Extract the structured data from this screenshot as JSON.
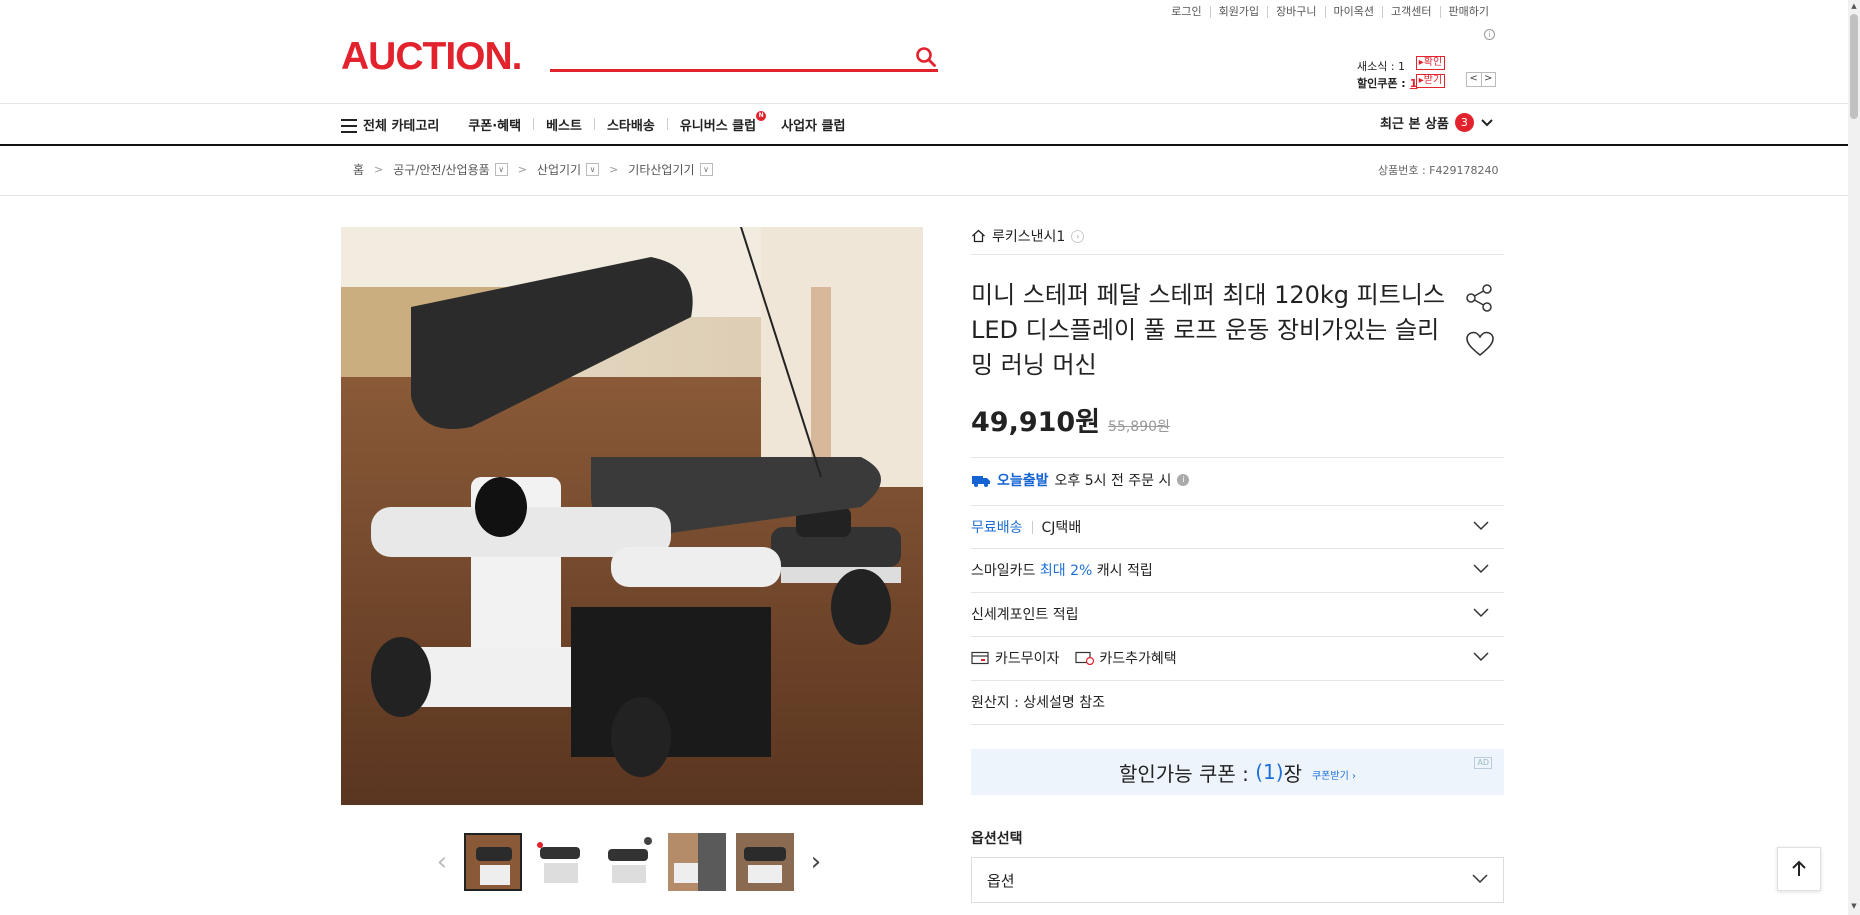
{
  "top_links": [
    "로그인",
    "회원가입",
    "장바구니",
    "마이옥션",
    "고객센터",
    "판매하기"
  ],
  "logo": "AUCTION.",
  "search": {
    "placeholder": ""
  },
  "mini": {
    "news_label": "새소식 : 1",
    "news_btn": "▸확인",
    "coupon_label": "할인쿠폰 :",
    "coupon_count": "1",
    "coupon_btn": "▸받기",
    "prev": "<",
    "next": ">"
  },
  "nav": {
    "all_category": "전체 카테고리",
    "items": [
      "쿠폰·혜택",
      "베스트",
      "스타배송",
      "유니버스 클럽",
      "사업자 클럽"
    ],
    "recent_label": "최근 본 상품",
    "recent_count": "3"
  },
  "breadcrumb": [
    "홈",
    "공구/안전/산업용품",
    "산업기기",
    "기타산업기기"
  ],
  "product_no": "상품번호 : F429178240",
  "seller": "루키스낸시1",
  "title": "미니 스테퍼 페달 스테퍼 최대 120kg 피트니스 LED 디스플레이 풀 로프 운동 장비가있는 슬리밍 러닝 머신",
  "price": {
    "now": "49,910원",
    "original": "55,890원"
  },
  "today": {
    "badge": "오늘출발",
    "text": "오후 5시 전 주문 시"
  },
  "rows": {
    "shipping_free": "무료배송",
    "shipping_carrier": "CJ택배",
    "smile_a": "스마일카드",
    "smile_b": "최대 2%",
    "smile_c": "캐시 적립",
    "ssg": "신세계포인트 적립",
    "card_interest": "카드무이자",
    "card_benefit": "카드추가혜택",
    "origin": "원산지 : 상세설명 참조"
  },
  "coupon": {
    "label": "할인가능 쿠폰 :",
    "count": "(1)",
    "unit": "장",
    "get": "쿠폰받기 ›",
    "ad": "AD"
  },
  "options": {
    "label": "옵션선택",
    "placeholder": "옵션"
  },
  "colors": {
    "brand": "#e2232d",
    "link": "#1d6fd8"
  }
}
